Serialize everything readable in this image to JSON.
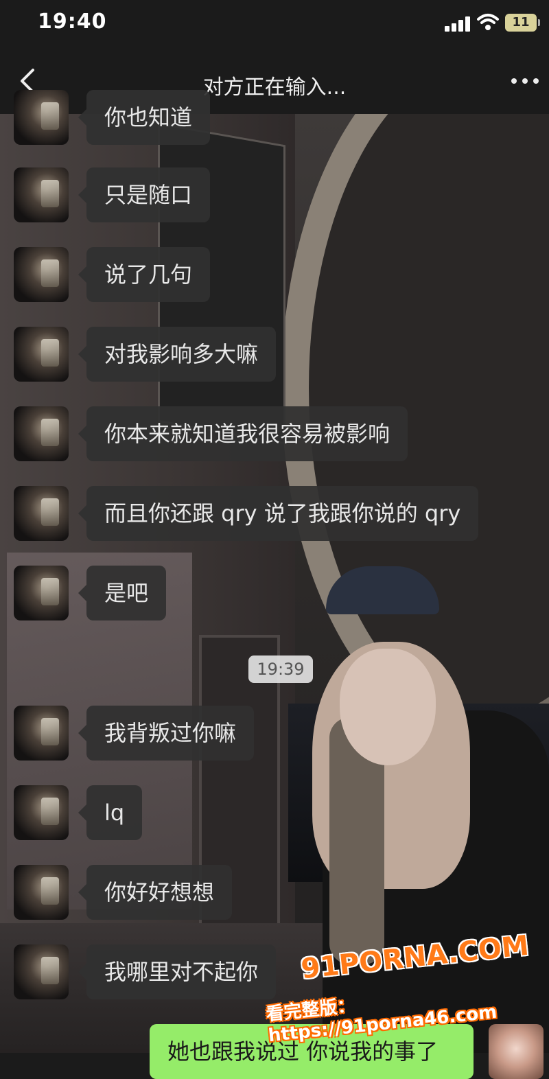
{
  "status_bar": {
    "time": "19:40",
    "battery": "11"
  },
  "nav": {
    "title": "对方正在输入..."
  },
  "messages": [
    {
      "text": "你也知道"
    },
    {
      "text": "只是随口"
    },
    {
      "text": "说了几句"
    },
    {
      "text": "对我影响多大嘛"
    },
    {
      "text": "你本来就知道我很容易被影响"
    },
    {
      "text": "而且你还跟 qry 说了我跟你说的 qry"
    },
    {
      "text": "是吧"
    },
    {
      "text": "我背叛过你嘛"
    },
    {
      "text": "lq"
    },
    {
      "text": "你好好想想"
    },
    {
      "text": "我哪里对不起你"
    }
  ],
  "time_divider": "19:39",
  "my_message": {
    "text": "她也跟我说过 你说我的事了"
  },
  "watermark": {
    "logo": "91PORNA.COM",
    "url": "看完整版：https://91porna46.com"
  },
  "colors": {
    "incoming_bubble": "#303030",
    "outgoing_bubble": "#95ec69",
    "bar": "#1b1b1b"
  }
}
